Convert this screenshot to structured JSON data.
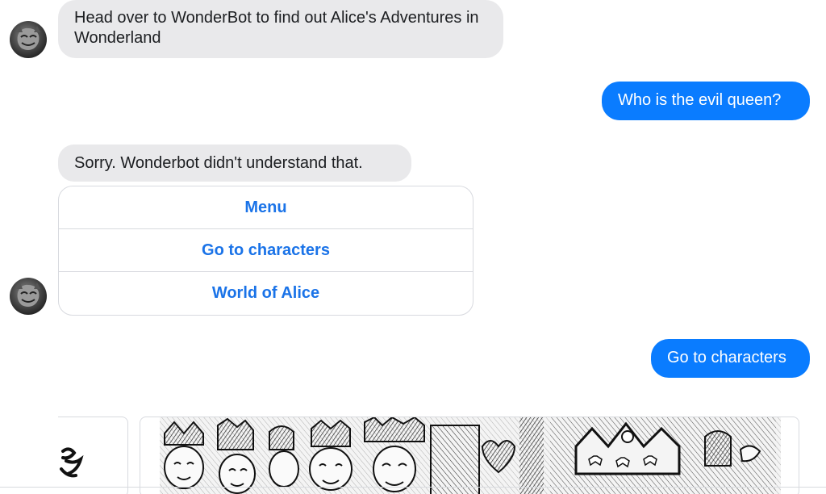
{
  "messages": {
    "bot_welcome": "Head over to WonderBot to find out Alice's Adventures in Wonderland",
    "user_question": "Who is the evil queen?",
    "bot_fallback": "Sorry. Wonderbot didn't understand that.",
    "user_choice": "Go to characters"
  },
  "quick_replies": [
    {
      "label": "Menu"
    },
    {
      "label": "Go to characters"
    },
    {
      "label": "World of Alice"
    }
  ],
  "colors": {
    "outgoing_bubble": "#0a7cff",
    "incoming_bubble": "#e9e9eb",
    "quick_reply_text": "#1a73e8"
  }
}
